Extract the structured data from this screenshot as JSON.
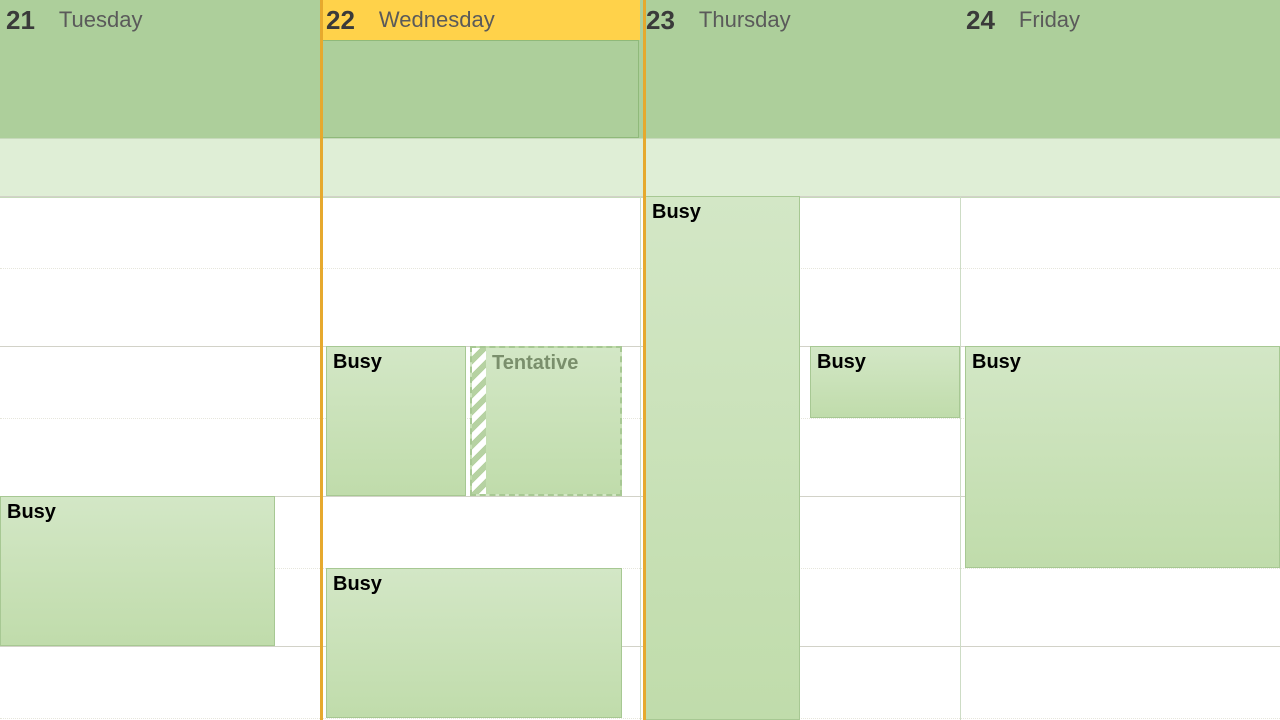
{
  "days": [
    {
      "num": "21",
      "name": "Tuesday",
      "today": false
    },
    {
      "num": "22",
      "name": "Wednesday",
      "today": true
    },
    {
      "num": "23",
      "name": "Thursday",
      "today": false
    },
    {
      "num": "24",
      "name": "Friday",
      "today": false
    }
  ],
  "labels": {
    "busy": "Busy",
    "tentative": "Tentative"
  },
  "events": {
    "tue_busy": {
      "label_key": "busy"
    },
    "wed_busy_top": {
      "label_key": "busy"
    },
    "wed_tentative": {
      "label_key": "tentative"
    },
    "wed_busy_bot": {
      "label_key": "busy"
    },
    "thu_busy_long": {
      "label_key": "busy"
    },
    "thu_busy_short": {
      "label_key": "busy"
    },
    "fri_busy": {
      "label_key": "busy"
    }
  }
}
